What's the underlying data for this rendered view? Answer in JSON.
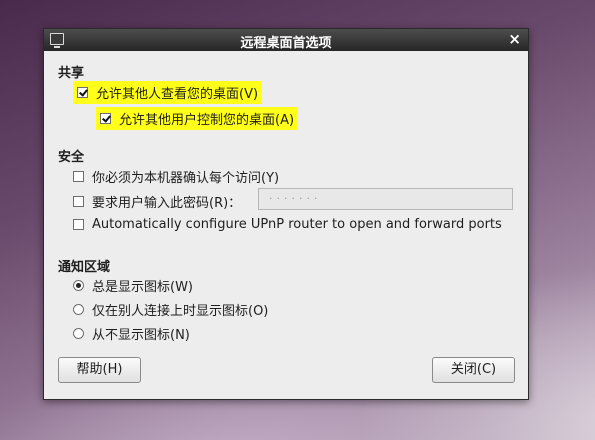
{
  "window": {
    "title": "远程桌面首选项",
    "close_glyph": "×",
    "icon": "remote-desktop-icon"
  },
  "sharing": {
    "title": "共享",
    "allow_view": {
      "label": "允许其他人查看您的桌面(V)",
      "checked": true
    },
    "allow_control": {
      "label": "允许其他用户控制您的桌面(A)",
      "checked": true
    }
  },
  "security": {
    "title": "安全",
    "confirm_access": {
      "label": "你必须为本机器确认每个访问(Y)",
      "checked": false
    },
    "require_password": {
      "label": "要求用户输入此密码(R)：",
      "checked": false
    },
    "password_value": "·······",
    "upnp": {
      "label": "Automatically configure UPnP router to open and forward ports",
      "checked": false
    }
  },
  "notification": {
    "title": "通知区域",
    "options": [
      {
        "label": "总是显示图标(W)",
        "selected": true
      },
      {
        "label": "仅在别人连接上时显示图标(O)",
        "selected": false
      },
      {
        "label": "从不显示图标(N)",
        "selected": false
      }
    ]
  },
  "buttons": {
    "help": "帮助(H)",
    "close": "关闭(C)"
  },
  "colors": {
    "highlight": "#ffff1a",
    "titlebar": "#333333",
    "dialog_bg": "#ededed"
  }
}
